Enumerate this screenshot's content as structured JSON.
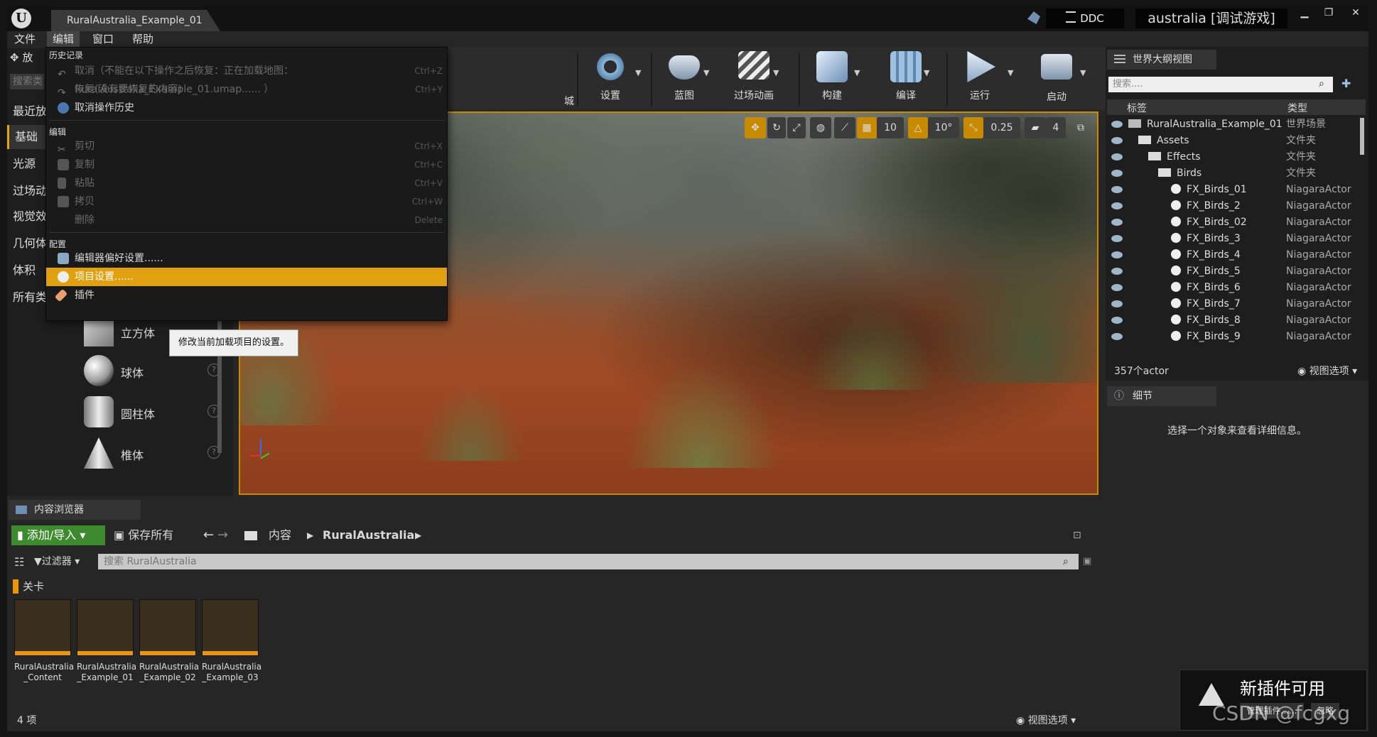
{
  "titlebar": {
    "tab": "RuralAustralia_Example_01",
    "ddc": "DDC",
    "project": "australia [调试游戏]"
  },
  "menubar": {
    "items": [
      "文件",
      "编辑",
      "窗口",
      "帮助"
    ]
  },
  "place_panel": {
    "tab_fragment": "放",
    "search_fragment": "搜索类",
    "categories": [
      "最近放",
      "基础",
      "光源",
      "过场动",
      "视觉效",
      "几何体",
      "体积",
      "所有类"
    ],
    "items": [
      "立方体",
      "球体",
      "圆柱体",
      "椎体"
    ]
  },
  "toolbar": {
    "partial_label": "城",
    "buttons": [
      "设置",
      "蓝图",
      "过场动画",
      "构建",
      "编译",
      "运行",
      "启动"
    ]
  },
  "viewport": {
    "grid": "10",
    "rot": "10°",
    "scale": "0.25",
    "speed": "4"
  },
  "edit_menu": {
    "sections": {
      "history": "历史记录",
      "edit": "编辑",
      "config": "配置"
    },
    "undo": "取消（不能在以下操作之后恢复：正在加载地图：RuralAustralia_Example_01.umap...... ）",
    "undo_sc": "Ctrl+Z",
    "redo": "恢复(没有要恢复的内容)",
    "redo_sc": "Ctrl+Y",
    "clear_history": "取消操作历史",
    "cut": "剪切",
    "cut_sc": "Ctrl+X",
    "copy": "复制",
    "copy_sc": "Ctrl+C",
    "paste": "粘贴",
    "paste_sc": "Ctrl+V",
    "duplicate": "拷贝",
    "duplicate_sc": "Ctrl+W",
    "delete": "删除",
    "delete_sc": "Delete",
    "editor_prefs": "编辑器偏好设置......",
    "project_settings": "项目设置......",
    "plugins": "插件"
  },
  "tooltip": "修改当前加载项目的设置。",
  "outliner": {
    "tab": "世界大纲视图",
    "search_placeholder": "搜索....",
    "col_label": "标签",
    "col_type": "类型",
    "rows": [
      {
        "name": "RuralAustralia_Example_01",
        "type": "世界场景"
      },
      {
        "name": "Assets",
        "type": "文件夹"
      },
      {
        "name": "Effects",
        "type": "文件夹"
      },
      {
        "name": "Birds",
        "type": "文件夹"
      },
      {
        "name": "FX_Birds_01",
        "type": "NiagaraActor"
      },
      {
        "name": "FX_Birds_2",
        "type": "NiagaraActor"
      },
      {
        "name": "FX_Birds_02",
        "type": "NiagaraActor"
      },
      {
        "name": "FX_Birds_3",
        "type": "NiagaraActor"
      },
      {
        "name": "FX_Birds_4",
        "type": "NiagaraActor"
      },
      {
        "name": "FX_Birds_5",
        "type": "NiagaraActor"
      },
      {
        "name": "FX_Birds_6",
        "type": "NiagaraActor"
      },
      {
        "name": "FX_Birds_7",
        "type": "NiagaraActor"
      },
      {
        "name": "FX_Birds_8",
        "type": "NiagaraActor"
      },
      {
        "name": "FX_Birds_9",
        "type": "NiagaraActor"
      }
    ],
    "count": "357个actor",
    "view_options": "视图选项"
  },
  "details": {
    "tab": "细节",
    "empty": "选择一个对象来查看详细信息。"
  },
  "content_browser": {
    "tab": "内容浏览器",
    "add_import": "添加/导入",
    "save_all": "保存所有",
    "path_root": "内容",
    "path_current": "RuralAustralia",
    "filters": "过滤器",
    "search_placeholder": "搜索 RuralAustralia",
    "filter_chip": "关卡",
    "assets": [
      {
        "line1": "RuralAustralia",
        "line2": "_Content"
      },
      {
        "line1": "RuralAustralia",
        "line2": "_Example_01"
      },
      {
        "line1": "RuralAustralia",
        "line2": "_Example_02"
      },
      {
        "line1": "RuralAustralia",
        "line2": "_Example_03"
      }
    ],
    "count": "4 项",
    "view_options": "视图选项"
  },
  "notification": {
    "title": "新插件可用",
    "manage": "管理插件......",
    "ignore": "忽略"
  },
  "watermark": "CSDN @fcgxg"
}
